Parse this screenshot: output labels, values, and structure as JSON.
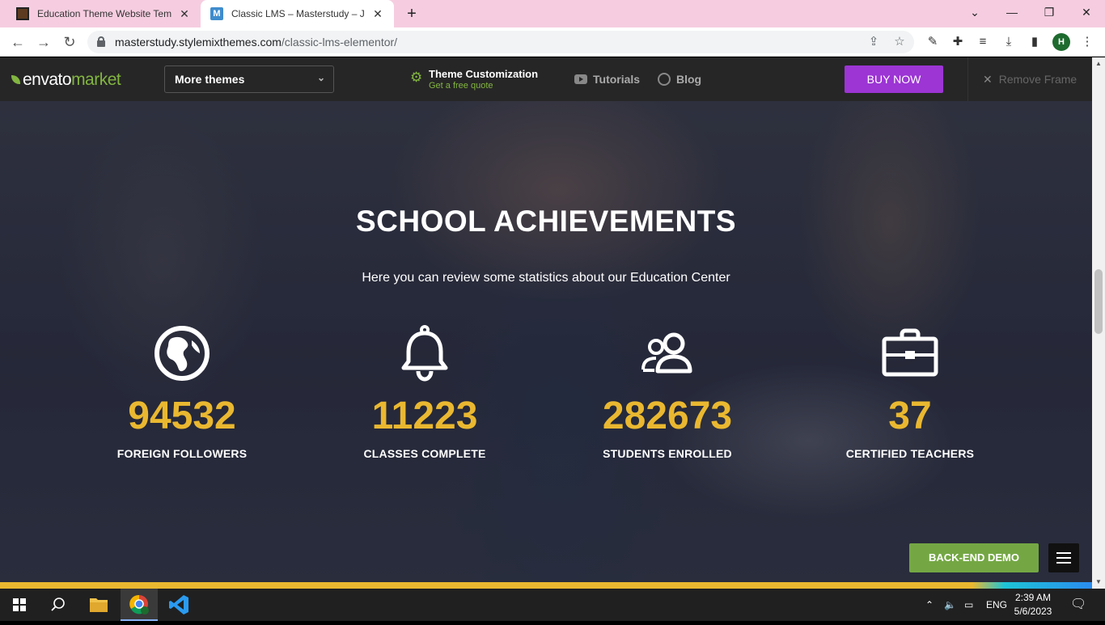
{
  "browser": {
    "tabs": [
      {
        "title": "Education Theme Website Templ",
        "active": false
      },
      {
        "title": "Classic LMS – Masterstudy – Just",
        "active": true,
        "favicon_letter": "M"
      }
    ],
    "address": {
      "domain": "masterstudy.stylemixthemes.com",
      "path": "/classic-lms-elementor/"
    },
    "profile_initial": "H"
  },
  "envato": {
    "logo_prefix": "envato",
    "logo_suffix": "market",
    "more_themes": "More themes",
    "customization_title": "Theme Customization",
    "customization_sub": "Get a free quote",
    "tutorials": "Tutorials",
    "blog": "Blog",
    "buy_now": "BUY NOW",
    "remove_frame": "Remove Frame"
  },
  "hero": {
    "title": "SCHOOL ACHIEVEMENTS",
    "subtitle": "Here you can review some statistics about our Education Center",
    "stats": [
      {
        "icon": "globe-icon",
        "value": "94532",
        "label": "FOREIGN FOLLOWERS"
      },
      {
        "icon": "bell-icon",
        "value": "11223",
        "label": "CLASSES COMPLETE"
      },
      {
        "icon": "users-icon",
        "value": "282673",
        "label": "STUDENTS ENROLLED"
      },
      {
        "icon": "briefcase-icon",
        "value": "37",
        "label": "CERTIFIED TEACHERS"
      }
    ],
    "backend_demo": "BACK-END DEMO"
  },
  "colors": {
    "accent_yellow": "#eab830",
    "envato_green": "#82b541",
    "buy_purple": "#9c35d4",
    "backend_green": "#74a744"
  },
  "taskbar": {
    "language": "ENG",
    "time": "2:39 AM",
    "date": "5/6/2023"
  }
}
